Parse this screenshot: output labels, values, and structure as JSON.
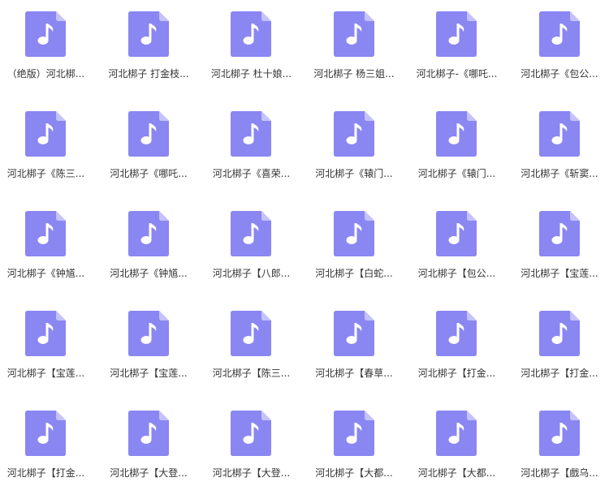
{
  "colors": {
    "file_body": "#8a86f2",
    "file_fold": "#c4c2fa",
    "note": "#ffffff",
    "label_text": "#333333"
  },
  "icon": "music-file-icon",
  "files": [
    {
      "label": "（绝版）河北梆..."
    },
    {
      "label": "河北梆子  打金枝..."
    },
    {
      "label": "河北梆子 杜十娘..."
    },
    {
      "label": "河北梆子 杨三姐..."
    },
    {
      "label": "河北梆子-《哪吒..."
    },
    {
      "label": "河北梆子《包公..."
    },
    {
      "label": "河北梆子《陈三..."
    },
    {
      "label": "河北梆子《哪吒..."
    },
    {
      "label": "河北梆子《喜荣..."
    },
    {
      "label": "河北梆子《辕门..."
    },
    {
      "label": "河北梆子《辕门..."
    },
    {
      "label": "河北梆子《斩窦..."
    },
    {
      "label": "河北梆子《钟馗..."
    },
    {
      "label": "河北梆子《钟馗..."
    },
    {
      "label": "河北梆子【八郎..."
    },
    {
      "label": "河北梆子【白蛇..."
    },
    {
      "label": "河北梆子【包公..."
    },
    {
      "label": "河北梆子【宝莲..."
    },
    {
      "label": "河北梆子【宝莲..."
    },
    {
      "label": "河北梆子【宝莲..."
    },
    {
      "label": "河北梆子【陈三..."
    },
    {
      "label": "河北梆子【春草..."
    },
    {
      "label": "河北梆子【打金..."
    },
    {
      "label": "河北梆子【打金..."
    },
    {
      "label": "河北梆子【打金..."
    },
    {
      "label": "河北梆子【大登..."
    },
    {
      "label": "河北梆子【大登..."
    },
    {
      "label": "河北梆子【大都..."
    },
    {
      "label": "河北梆子【大都..."
    },
    {
      "label": "河北梆子【戲乌..."
    }
  ]
}
